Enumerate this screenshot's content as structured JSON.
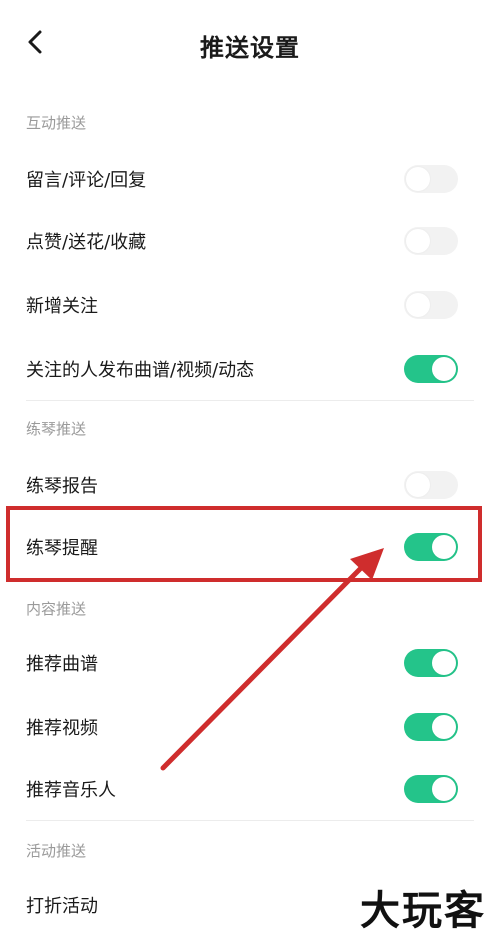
{
  "header": {
    "title": "推送设置",
    "back_icon": "chevron-left-icon"
  },
  "sections": [
    {
      "title": "互动推送",
      "items": [
        {
          "label": "留言/评论/回复",
          "enabled": false
        },
        {
          "label": "点赞/送花/收藏",
          "enabled": false
        },
        {
          "label": "新增关注",
          "enabled": false
        },
        {
          "label": "关注的人发布曲谱/视频/动态",
          "enabled": true
        }
      ]
    },
    {
      "title": "练琴推送",
      "items": [
        {
          "label": "练琴报告",
          "enabled": false
        },
        {
          "label": "练琴提醒",
          "enabled": true
        }
      ]
    },
    {
      "title": "内容推送",
      "items": [
        {
          "label": "推荐曲谱",
          "enabled": true
        },
        {
          "label": "推荐视频",
          "enabled": true
        },
        {
          "label": "推荐音乐人",
          "enabled": true
        }
      ]
    },
    {
      "title": "活动推送",
      "items": [
        {
          "label": "打折活动",
          "enabled": false
        }
      ]
    }
  ],
  "annotation": {
    "color": "#cf2d2d"
  },
  "colors": {
    "toggle_on": "#24c48a",
    "toggle_off": "#f2f2f2",
    "section_header": "#9a9a9a"
  },
  "watermark": {
    "text": "大玩客"
  }
}
